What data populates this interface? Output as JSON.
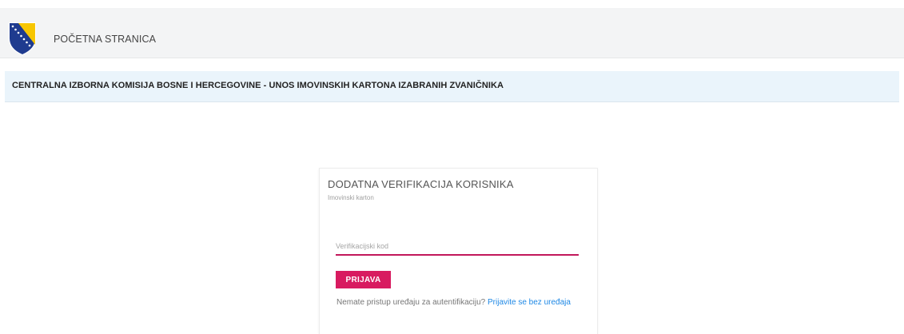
{
  "nav": {
    "home_label": "POČETNA STRANICA",
    "logo_icon": "bih-coat-of-arms-icon"
  },
  "banner": {
    "text": "CENTRALNA IZBORNA KOMISIJA BOSNE I HERCEGOVINE - UNOS IMOVINSKIH KARTONA IZABRANIH ZVANIČNIKA"
  },
  "card": {
    "title": "DODATNA VERIFIKACIJA KORISNIKA",
    "subtitle": "Imovinski karton",
    "code_input": {
      "value": "",
      "placeholder": "Verifikacijski kod"
    },
    "submit_label": "PRIJAVA",
    "help_text": "Nemate pristup uređaju za autentifikaciju?",
    "help_link": "Prijavite se bez uređaja"
  },
  "colors": {
    "accent": "#d81b60",
    "link": "#1e88e5",
    "navbar_bg": "#f3f4f5",
    "banner_bg": "#eaf4fb"
  }
}
